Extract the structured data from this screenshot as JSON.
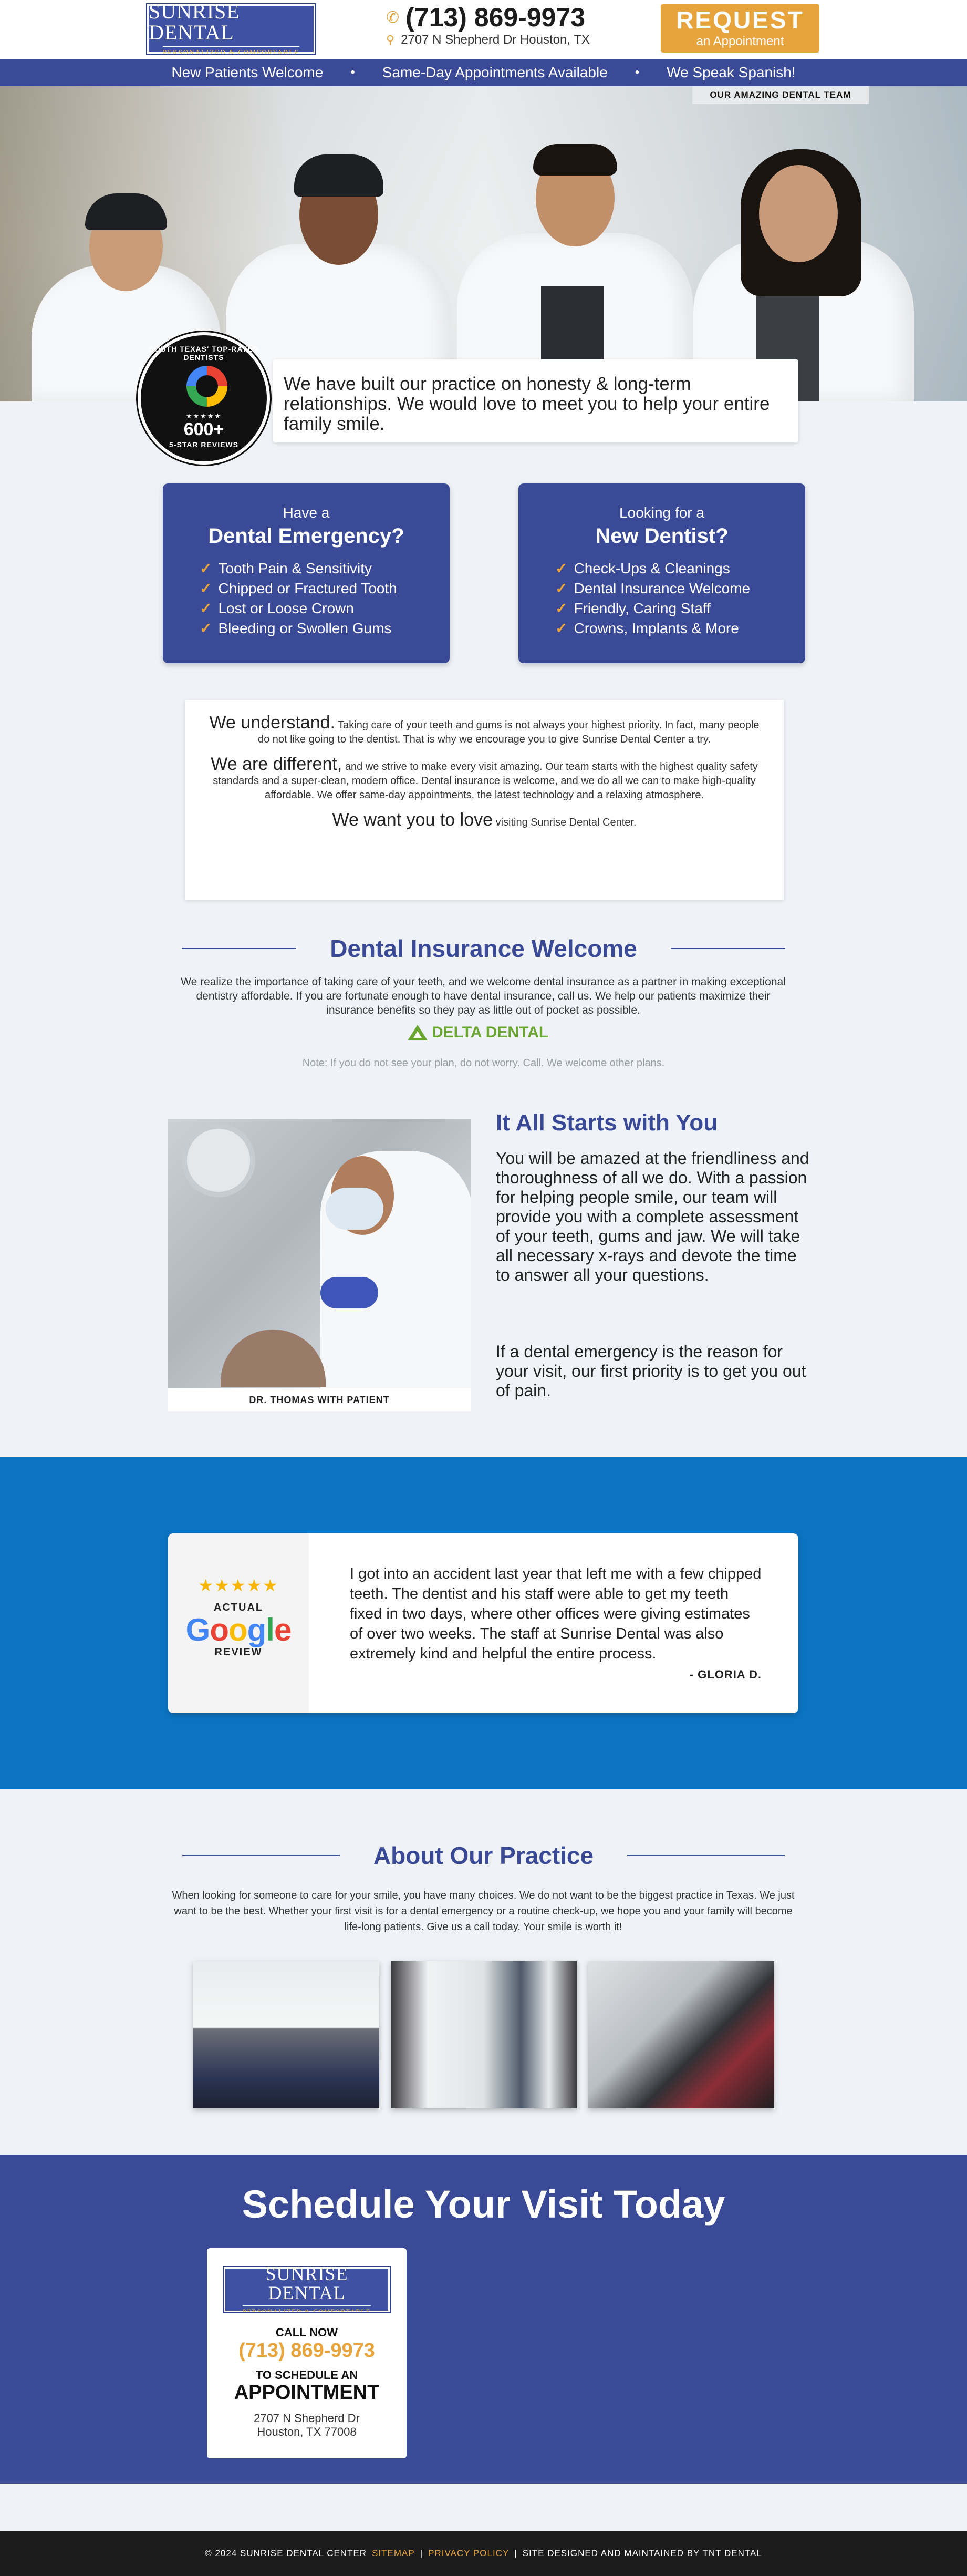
{
  "header": {
    "logo_main": "SUNRISE DENTAL",
    "logo_sub": "PERSONALIZED & COMFORTABLE",
    "phone": "(713) 869-9973",
    "address": "2707 N Shepherd Dr Houston, TX",
    "request_big": "REQUEST",
    "request_small": "an Appointment"
  },
  "bar": {
    "items": [
      "New Patients Welcome",
      "Same-Day Appointments Available",
      "We Speak Spanish!"
    ],
    "separator": "•"
  },
  "hero": {
    "team_label": "OUR AMAZING DENTAL TEAM",
    "badge_top": "SOUTH TEXAS' TOP-RATED DENTISTS",
    "badge_stars": "★★★★★",
    "badge_count": "600+",
    "badge_bottom": "5-STAR REVIEWS",
    "intro": "We have built our practice on honesty & long-term relationships. We would love to meet you to help your entire family smile."
  },
  "emergency": {
    "pre": "Have a",
    "title": "Dental Emergency?",
    "items": [
      "Tooth Pain & Sensitivity",
      "Chipped or Fractured Tooth",
      "Lost or Loose Crown",
      "Bleeding or Swollen Gums"
    ]
  },
  "new_dentist": {
    "pre": "Looking for a",
    "title": "New Dentist?",
    "items": [
      "Check-Ups & Cleanings",
      "Dental Insurance Welcome",
      "Friendly, Caring Staff",
      "Crowns, Implants & More"
    ]
  },
  "understand": {
    "p1_lead": "We understand.",
    "p1_text": " Taking care of your teeth and gums is not always your highest priority. In fact, many people do not like going to the dentist. That is why we encourage you to give Sunrise Dental Center a try.",
    "p2_lead": "We are different,",
    "p2_text": " and we strive to make every visit amazing. Our team starts with the highest quality safety standards and a super-clean, modern office. Dental insurance is welcome, and we do all we can to make high-quality affordable. We offer same-day appointments, the latest technology and a relaxing atmosphere.",
    "p3_lead": "We want you to love",
    "p3_text": " visiting Sunrise Dental Center."
  },
  "insurance": {
    "title": "Dental Insurance Welcome",
    "text": "We realize the importance of taking care of your teeth, and we welcome dental insurance as a partner in making exceptional dentistry affordable. If you are fortunate enough to have dental insurance, call us. We help our patients maximize their insurance benefits so they pay as little out of pocket as possible.",
    "logo": "DELTA DENTAL",
    "note": "Note: If you do not see your plan, do not worry. Call. We welcome other plans."
  },
  "starts": {
    "photo_caption": "DR. THOMAS WITH PATIENT",
    "title": "It All Starts with You",
    "p1": "You will be amazed at the friendliness and thoroughness of all we do. With a passion for helping people smile, our team will provide you with a complete assessment of your teeth, gums and jaw. We will take all necessary x-rays and devote the time to answer all your questions.",
    "p2": "If a dental emergency is the reason for your visit, our first priority is to get you out of pain."
  },
  "testimonial": {
    "stars": "★★★★★",
    "actual": "ACTUAL",
    "google": "Google",
    "review": "REVIEW",
    "quote": "I got into an accident last year that left me with a few chipped teeth. The dentist and his staff were able to get my teeth fixed in two days, where other offices were giving estimates of over two weeks. The staff at Sunrise Dental was also extremely kind and helpful the entire process.",
    "author": "- GLORIA D."
  },
  "about": {
    "title": "About Our Practice",
    "text": "When looking for someone to care for your smile, you have many choices. We do not want to be the biggest practice in Texas. We just want to be the best. Whether your first visit is for a dental emergency or a routine check-up, we hope you and your family will become life-long patients. Give us a call today. Your smile is worth it!"
  },
  "schedule": {
    "title": "Schedule Your Visit Today",
    "call_now": "CALL NOW",
    "phone": "(713) 869-9973",
    "to_schedule": "TO SCHEDULE AN",
    "appointment": "APPOINTMENT",
    "addr1": "2707 N Shepherd Dr",
    "addr2": "Houston, TX 77008"
  },
  "footer": {
    "copyright": "© 2024 SUNRISE DENTAL CENTER",
    "sitemap": "SITEMAP",
    "privacy": "PRIVACY POLICY",
    "credit": "SITE DESIGNED AND MAINTAINED BY TNT DENTAL",
    "sep": "|"
  },
  "colors": {
    "brand_blue": "#3a4a96",
    "accent_gold": "#e8a43c",
    "band_blue": "#0b74c2"
  }
}
